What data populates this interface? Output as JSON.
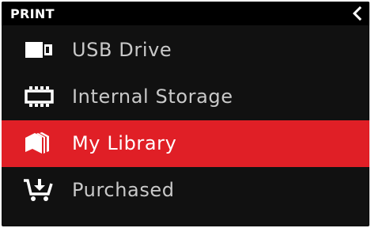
{
  "header": {
    "title": "PRINT",
    "back_icon": "chevron-left-icon"
  },
  "menu": {
    "items": [
      {
        "label": "USB Drive",
        "icon": "usb-drive-icon",
        "selected": false
      },
      {
        "label": "Internal Storage",
        "icon": "internal-storage-icon",
        "selected": false
      },
      {
        "label": "My Library",
        "icon": "library-icon",
        "selected": true
      },
      {
        "label": "Purchased",
        "icon": "cart-download-icon",
        "selected": false
      }
    ]
  },
  "colors": {
    "background": "#111111",
    "header_background": "#000000",
    "selected_background": "#e01f26",
    "text": "#c9c9c9",
    "selected_text": "#ffffff"
  }
}
